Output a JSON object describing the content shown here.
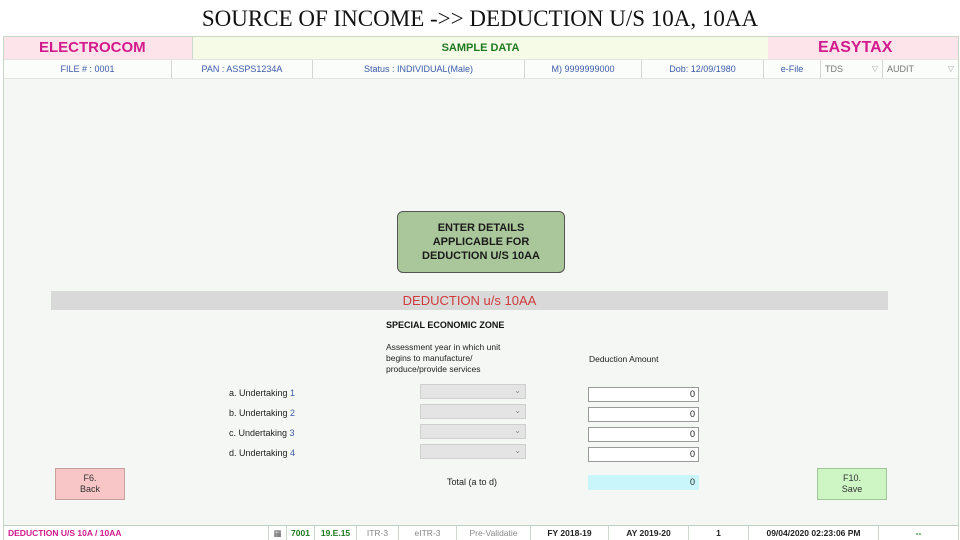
{
  "slide_title": "SOURCE OF INCOME ->> DEDUCTION U/S 10A, 10AA",
  "brand": {
    "left": "ELECTROCOM",
    "center": "SAMPLE DATA",
    "right": "EASYTAX"
  },
  "info": {
    "file": "FILE # : 0001",
    "pan": "PAN : ASSPS1234A",
    "status": "Status : INDIVIDUAL(Male)",
    "mobile": "M) 9999999000",
    "dob": "Dob: 12/09/1980",
    "efile": "e-File",
    "tds": "TDS",
    "audit": "AUDIT"
  },
  "hint": "ENTER DETAILS APPLICABLE FOR DEDUCTION U/S 10AA",
  "section_title": "DEDUCTION u/s 10AA",
  "sez_heading": "SPECIAL ECONOMIC ZONE",
  "columns": {
    "year": "Assessment year in which unit begins to manufacture/ produce/provide services",
    "amount": "Deduction Amount"
  },
  "rows": [
    {
      "label": "a. Undertaking ",
      "num": "1",
      "year": "",
      "amount": "0"
    },
    {
      "label": "b. Undertaking ",
      "num": "2",
      "year": "",
      "amount": "0"
    },
    {
      "label": "c. Undertaking ",
      "num": "3",
      "year": "",
      "amount": "0"
    },
    {
      "label": "d. Undertaking ",
      "num": "4",
      "year": "",
      "amount": "0"
    }
  ],
  "total": {
    "label": "Total (a to d)",
    "value": "0"
  },
  "buttons": {
    "back_key": "F6.",
    "back_label": "Back",
    "save_key": "F10.",
    "save_label": "Save"
  },
  "status_bar": {
    "module": "DEDUCTION U/S 10A / 10AA",
    "code": "7001",
    "version": "19.E.15",
    "itr": "ITR-3",
    "eitr": "eITR-3",
    "prevalid": "Pre-Validatie",
    "fy": "FY 2018-19",
    "ay": "AY 2019-20",
    "count": "1",
    "datetime": "09/04/2020 02:23:06 PM",
    "extra": "--"
  }
}
